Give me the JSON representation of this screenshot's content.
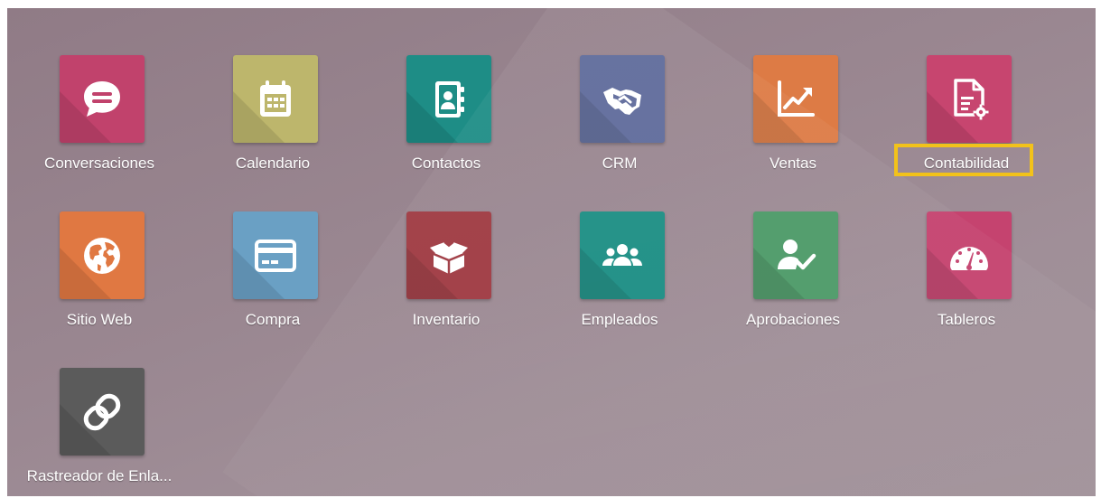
{
  "apps": [
    {
      "label": "Conversaciones",
      "icon": "chat-bubble-icon",
      "color": "#c1426c"
    },
    {
      "label": "Calendario",
      "icon": "calendar-icon",
      "color": "#bdb66c"
    },
    {
      "label": "Contactos",
      "icon": "address-book-icon",
      "color": "#1e8d86"
    },
    {
      "label": "CRM",
      "icon": "handshake-icon",
      "color": "#5f6b9b"
    },
    {
      "label": "Ventas",
      "icon": "chart-trending-up-icon",
      "color": "#dd7b45"
    },
    {
      "label": "Contabilidad",
      "icon": "invoice-gear-icon",
      "color": "#c7456f"
    },
    {
      "label": "Sitio Web",
      "icon": "globe-icon",
      "color": "#e07842"
    },
    {
      "label": "Compra",
      "icon": "credit-card-icon",
      "color": "#6aa0c4"
    },
    {
      "label": "Inventario",
      "icon": "box-icon",
      "color": "#9f3a42"
    },
    {
      "label": "Empleados",
      "icon": "people-group-icon",
      "color": "#1c8e84"
    },
    {
      "label": "Aprobaciones",
      "icon": "user-check-icon",
      "color": "#4d9a68"
    },
    {
      "label": "Tableros",
      "icon": "gauge-icon",
      "color": "#c5436f"
    },
    {
      "label": "Rastreador de Enla...",
      "icon": "link-icon",
      "color": "#5b5b5b"
    }
  ],
  "highlight_color": "#f2c21a"
}
